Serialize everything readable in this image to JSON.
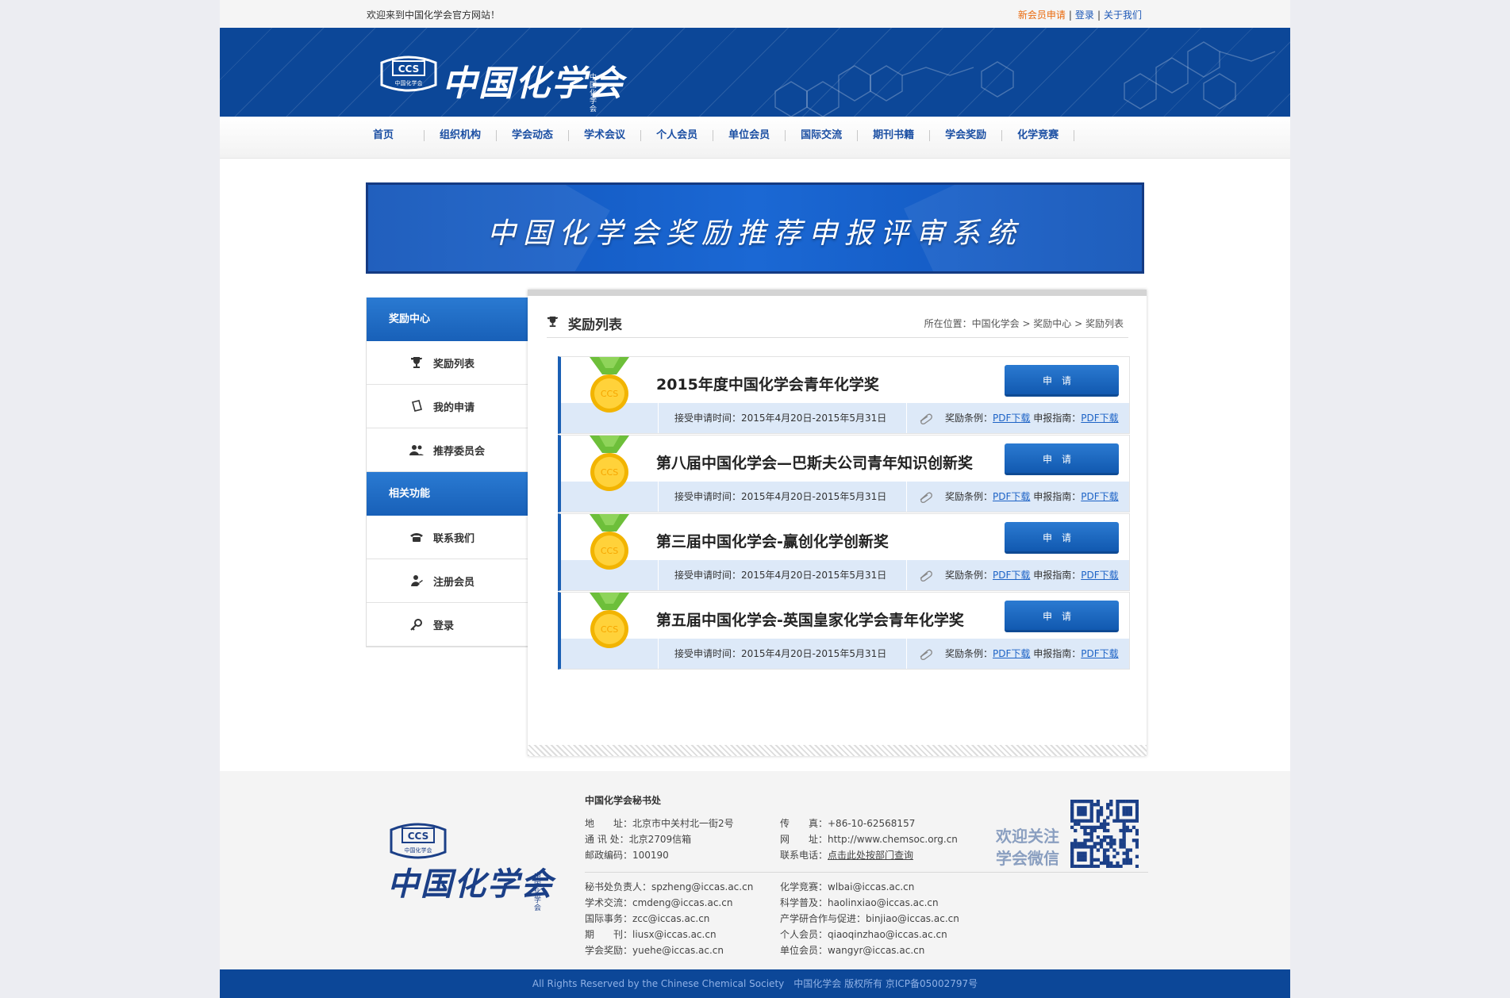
{
  "topbar": {
    "welcome": "欢迎来到中国化学会官方网站！",
    "new_member": "新会员申请",
    "sep": "|",
    "login": "登录",
    "about": "关于我们"
  },
  "header": {
    "logo_abbr": "CCS",
    "logo_sub": "中国化学会",
    "logo_name": "中国化学会",
    "logo_small": "中国化学会"
  },
  "nav": [
    "首页",
    "组织机构",
    "学会动态",
    "学术会议",
    "个人会员",
    "单位会员",
    "国际交流",
    "期刊书籍",
    "学会奖励",
    "化学竞赛"
  ],
  "banner": {
    "title": "中国化学会奖励推荐申报评审系统"
  },
  "sidebar": {
    "section1": "奖励中心",
    "items1": [
      "奖励列表",
      "我的申请",
      "推荐委员会"
    ],
    "section2": "相关功能",
    "items2": [
      "联系我们",
      "注册会员",
      "登录"
    ]
  },
  "content": {
    "title": "奖励列表",
    "breadcrumb": "所在位置：中国化学会 > 奖励中心 > 奖励列表",
    "medal_text": "CCS",
    "apply_label": "申请",
    "time_label": "接受申请时间：2015年4月20日-2015年5月31日",
    "rules_label": "奖励条例：",
    "guide_label": "申报指南：",
    "pdf_label": "PDF下载",
    "awards": [
      {
        "name": "2015年度中国化学会青年化学奖"
      },
      {
        "name": "第八届中国化学会—巴斯夫公司青年知识创新奖"
      },
      {
        "name": "第三届中国化学会-赢创化学创新奖"
      },
      {
        "name": "第五届中国化学会-英国皇家化学会青年化学奖"
      }
    ]
  },
  "footer": {
    "title": "中国化学会秘书处",
    "address": "地　　址：北京市中关村北一街2号",
    "mail": "通 讯 处：北京2709信箱",
    "postcode": "邮政编码：100190",
    "fax": "传　　真：+86-10-62568157",
    "website": "网　　址：http://www.chemsoc.org.cn",
    "phone_label": "联系电话：",
    "phone_link": "点击此处按部门查询",
    "contacts_left": [
      "秘书处负责人：spzheng@iccas.ac.cn",
      "学术交流：cmdeng@iccas.ac.cn",
      "国际事务：zcc@iccas.ac.cn",
      "期　　刊：liusx@iccas.ac.cn",
      "学会奖励：yuehe@iccas.ac.cn"
    ],
    "contacts_right": [
      "化学竞赛：wlbai@iccas.ac.cn",
      "科学普及：haolinxiao@iccas.ac.cn",
      "产学研合作与促进：binjiao@iccas.ac.cn",
      "个人会员：qiaoqinzhao@iccas.ac.cn",
      "单位会员：wangyr@iccas.ac.cn"
    ],
    "follow_line1": "欢迎关注",
    "follow_line2": "学会微信"
  },
  "copyright": "All Rights Reserved by the Chinese Chemical Society　中国化学会 版权所有 京ICP备05002797号"
}
